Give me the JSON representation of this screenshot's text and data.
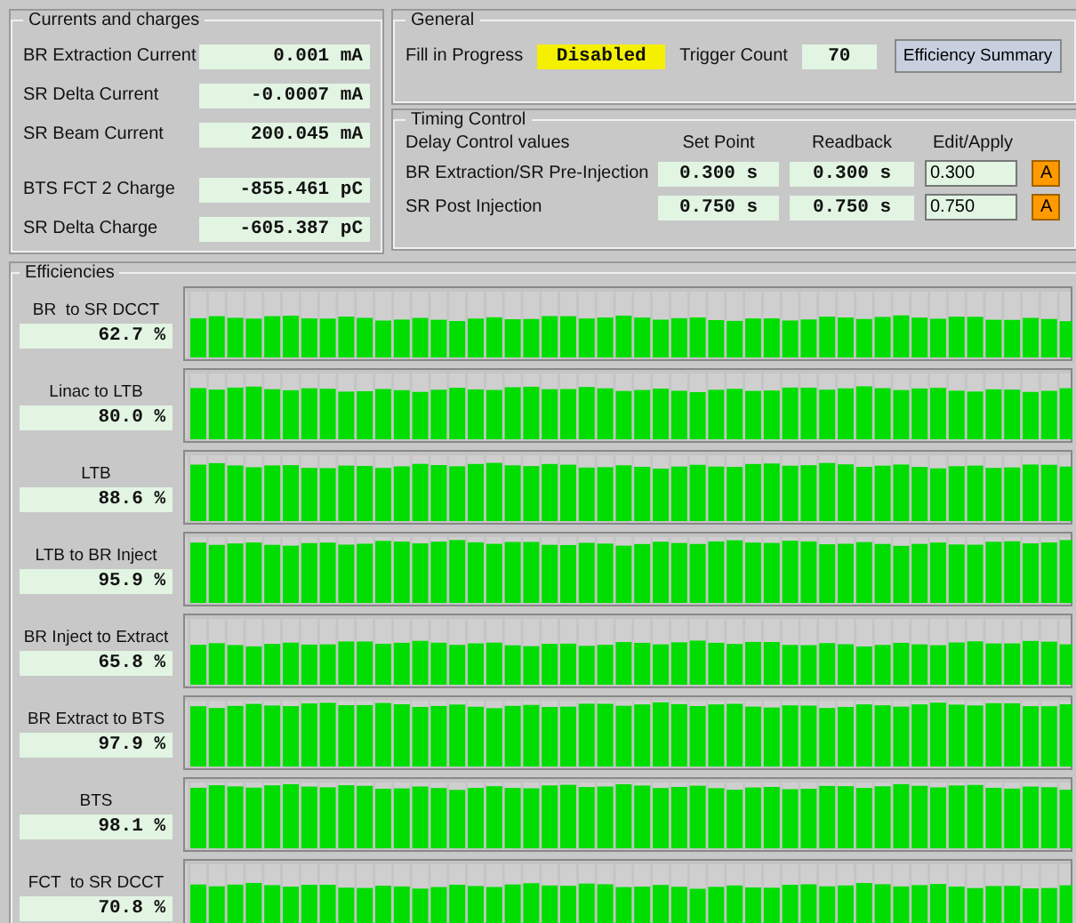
{
  "currents": {
    "title": "Currents and charges",
    "rows": [
      {
        "label": "BR Extraction Current",
        "value": "0.001 mA"
      },
      {
        "label": "SR Delta Current",
        "value": "-0.0007 mA"
      },
      {
        "label": "SR Beam Current",
        "value": "200.045 mA"
      },
      {
        "label": "BTS FCT 2 Charge",
        "value": "-855.461 pC"
      },
      {
        "label": "SR Delta Charge",
        "value": "-605.387 pC"
      }
    ]
  },
  "general": {
    "title": "General",
    "fill_label": "Fill in Progress",
    "fill_value": "Disabled",
    "trigger_label": "Trigger Count",
    "trigger_value": "70",
    "summary_button": "Efficiency Summary"
  },
  "timing": {
    "title": "Timing Control",
    "columns": [
      "Delay Control values",
      "Set Point",
      "Readback",
      "Edit/Apply"
    ],
    "rows": [
      {
        "label": "BR Extraction/SR Pre-Injection",
        "set_point": "0.300 s",
        "readback": "0.300 s",
        "edit": "0.300",
        "apply": "A"
      },
      {
        "label": "SR Post Injection",
        "set_point": "0.750 s",
        "readback": "0.750 s",
        "edit": "0.750",
        "apply": "A"
      }
    ]
  },
  "efficiencies": {
    "title": "Efficiencies",
    "rows": [
      {
        "label": "BR  to SR DCCT",
        "value": "62.7 %"
      },
      {
        "label": "Linac to LTB",
        "value": "80.0 %"
      },
      {
        "label": "LTB",
        "value": "88.6 %"
      },
      {
        "label": "LTB to BR Inject",
        "value": "95.9 %"
      },
      {
        "label": "BR Inject to Extract",
        "value": "65.8 %"
      },
      {
        "label": "BR Extract to BTS",
        "value": "97.9 %"
      },
      {
        "label": "BTS",
        "value": "98.1 %"
      },
      {
        "label": "FCT  to SR DCCT",
        "value": "70.8 %"
      }
    ]
  }
}
